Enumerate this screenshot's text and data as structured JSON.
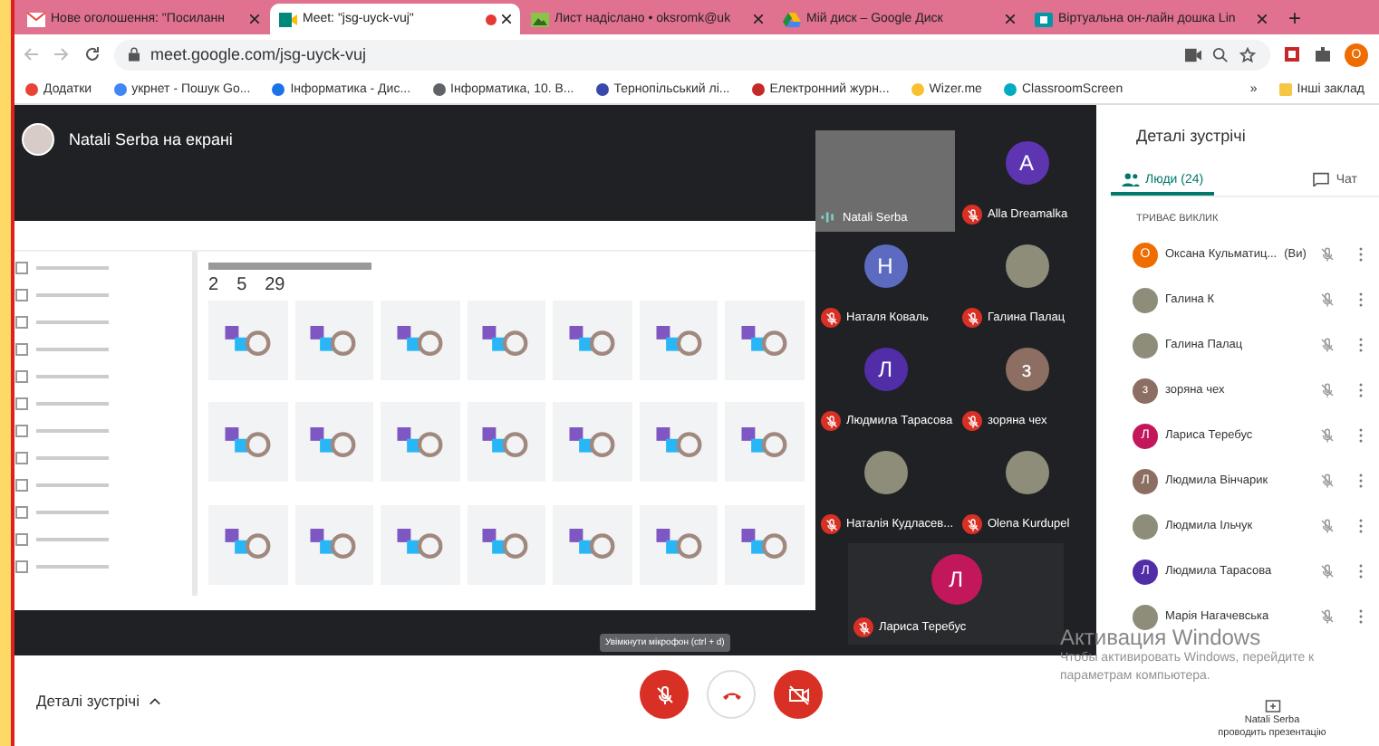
{
  "browser": {
    "tabs": [
      {
        "label": "Нове оголошення: \"Посиланн",
        "selected": false,
        "recording": false
      },
      {
        "label": "Meet: \"jsg-uyck-vuj\"",
        "selected": true,
        "recording": true
      },
      {
        "label": "Лист надіслано • oksromk@uk",
        "selected": false,
        "recording": false
      },
      {
        "label": "Мій диск – Google Диск",
        "selected": false,
        "recording": false
      },
      {
        "label": "Віртуальна он-лайн дошка Lin",
        "selected": false,
        "recording": false
      }
    ],
    "new_tab": "+",
    "url": "meet.google.com/jsg-uyck-vuj",
    "profile_letter": "O",
    "bookmarks": [
      {
        "label": "Додатки",
        "color": "#ea4335"
      },
      {
        "label": "укрнет - Пошук Go...",
        "color": "#4285f4"
      },
      {
        "label": "Інформатика - Дис...",
        "color": "#1a73e8"
      },
      {
        "label": "Інформатика, 10. В...",
        "color": "#5f6368"
      },
      {
        "label": "Тернопільський лі...",
        "color": "#3949ab"
      },
      {
        "label": "Електронний журн...",
        "color": "#c62828"
      },
      {
        "label": "Wizer.me",
        "color": "#fbc02d"
      },
      {
        "label": "ClassroomScreen",
        "color": "#00acc1"
      }
    ],
    "more_bookmarks": "»",
    "other_bookmarks": "Інші заклад"
  },
  "presenter_label": "Natali Serba на екрані",
  "shared_screen": {
    "stats": [
      {
        "value": "2"
      },
      {
        "value": "5"
      },
      {
        "value": "29"
      }
    ]
  },
  "tiles": [
    {
      "name": "Natali Serba",
      "kind": "video",
      "muted": false
    },
    {
      "name": "Alla Dreamalka",
      "kind": "letter",
      "letter": "A",
      "color": "#5e35b1",
      "muted": true
    },
    {
      "name": "Наталя Коваль",
      "kind": "letter",
      "letter": "Н",
      "color": "#5c6bc0",
      "muted": true
    },
    {
      "name": "Галина Палац",
      "kind": "photo",
      "muted": true
    },
    {
      "name": "Людмила Тарасова",
      "kind": "letter",
      "letter": "Л",
      "color": "#512da8",
      "muted": true
    },
    {
      "name": "зоряна чех",
      "kind": "letter",
      "letter": "з",
      "color": "#8d6e63",
      "muted": true
    },
    {
      "name": "Наталія Кудласев...",
      "kind": "photo",
      "muted": true
    },
    {
      "name": "Olena Kurdupel",
      "kind": "photo",
      "muted": true
    },
    {
      "name": "Лариса Теребус",
      "kind": "letter",
      "letter": "Л",
      "color": "#c2185b",
      "muted": true
    }
  ],
  "controls": {
    "details": "Деталі зустрічі",
    "tooltip": "Увімкнути мікрофон (ctrl + d)",
    "mic_on": false,
    "camera_on": false
  },
  "panel": {
    "title": "Деталі зустрічі",
    "tabs": [
      {
        "label": "Люди (24)",
        "kind": "people",
        "selected": true
      },
      {
        "label": "Чат",
        "kind": "chat",
        "selected": false
      }
    ],
    "section": "ТРИВАЄ ВИКЛИК",
    "participants": [
      {
        "name": "Оксана Кульматиц...",
        "suffix": "(Ви)",
        "kind": "letter",
        "letter": "О",
        "color": "#ef6c00",
        "muted": true
      },
      {
        "name": "Галина К",
        "kind": "photo",
        "muted": true
      },
      {
        "name": "Галина Палац",
        "kind": "photo",
        "muted": true
      },
      {
        "name": "зоряна чех",
        "kind": "letter",
        "letter": "з",
        "color": "#8d6e63",
        "muted": true
      },
      {
        "name": "Лариса Теребус",
        "kind": "letter",
        "letter": "Л",
        "color": "#c2185b",
        "muted": true
      },
      {
        "name": "Людмила Вінчарик",
        "kind": "letter",
        "letter": "Л",
        "color": "#8d6e63",
        "muted": true
      },
      {
        "name": "Людмила Ільчук",
        "kind": "photo",
        "muted": true
      },
      {
        "name": "Людмила Тарасова",
        "kind": "letter",
        "letter": "Л",
        "color": "#512da8",
        "muted": true
      },
      {
        "name": "Марія Нагачевська",
        "kind": "photo",
        "muted": true
      }
    ],
    "presenting_name": "Natali Serba",
    "presenting_text": "проводить презентацію"
  },
  "os_notice": {
    "title": "Активация Windows",
    "text": "Чтобы активировать Windows, перейдите к параметрам компьютера."
  }
}
